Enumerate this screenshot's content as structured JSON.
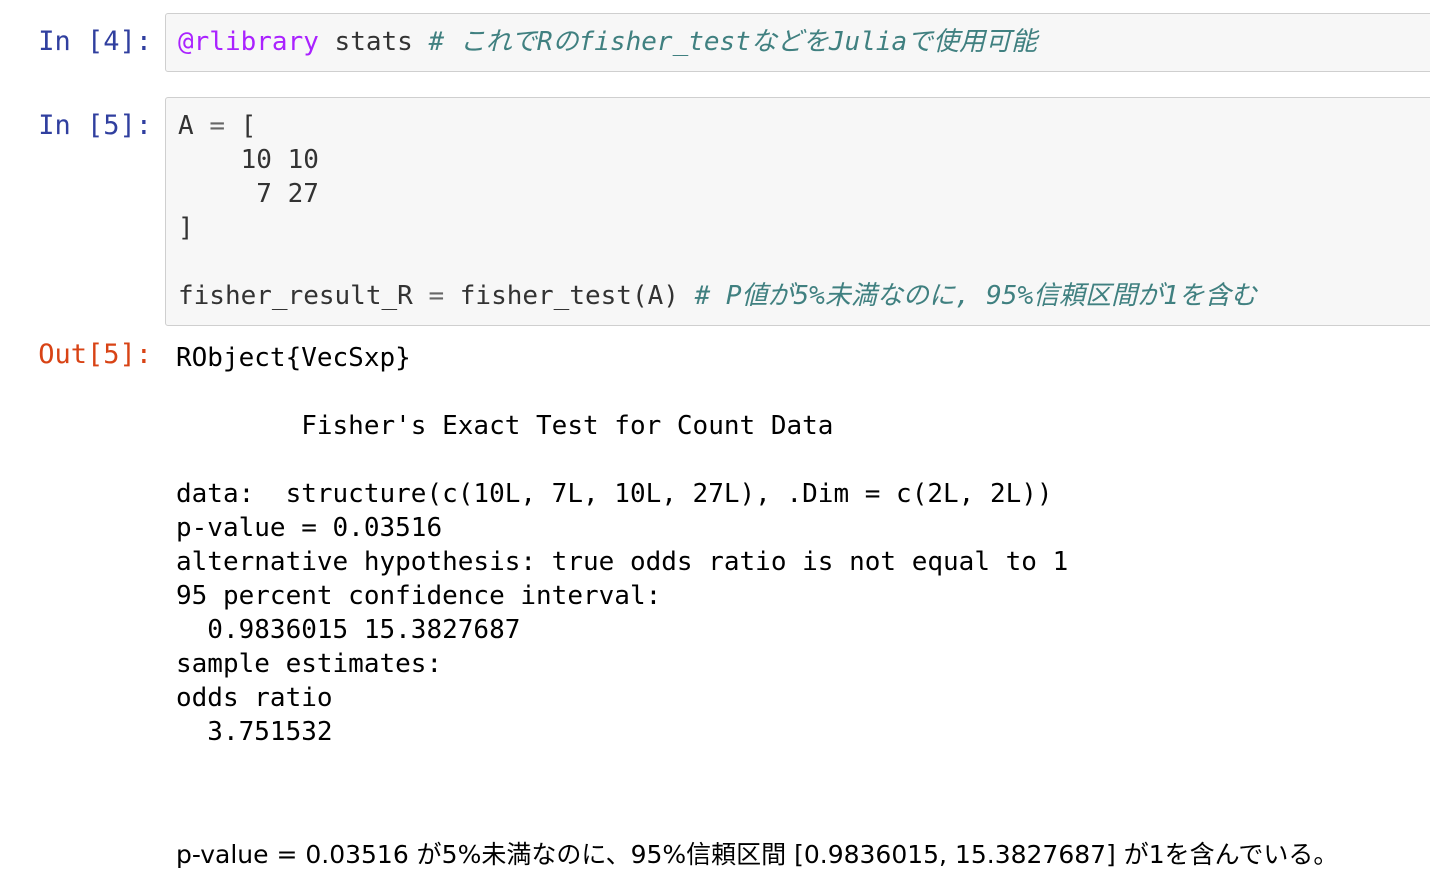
{
  "cells": [
    {
      "prompt": "In [4]:",
      "code": [
        {
          "text": "@rlibrary",
          "cls": "tok-macro"
        },
        {
          "text": " stats ",
          "cls": ""
        },
        {
          "text": "# これでRのfisher_testなどをJuliaで使用可能",
          "cls": "tok-comment"
        }
      ]
    },
    {
      "prompt": "In [5]:",
      "code": [
        {
          "text": "A ",
          "cls": ""
        },
        {
          "text": "=",
          "cls": "tok-op"
        },
        {
          "text": " [\n    10 10\n     7 27\n]\n\nfisher_result_R ",
          "cls": ""
        },
        {
          "text": "=",
          "cls": "tok-op"
        },
        {
          "text": " fisher_test(A) ",
          "cls": ""
        },
        {
          "text": "# P値が5%未満なのに, 95%信頼区間が1を含む",
          "cls": "tok-comment"
        }
      ]
    }
  ],
  "output": {
    "prompt": "Out[5]:",
    "lines": [
      "RObject{VecSxp}",
      "",
      "        Fisher's Exact Test for Count Data",
      "",
      "data:  structure(c(10L, 7L, 10L, 27L), .Dim = c(2L, 2L))",
      "p-value = 0.03516",
      "alternative hypothesis: true odds ratio is not equal to 1",
      "95 percent confidence interval:",
      "  0.9836015 15.3827687",
      "sample estimates:",
      "odds ratio",
      "  3.751532"
    ]
  },
  "caption": "p-value = 0.03516 が5%未満なのに、95%信頼区間 [0.9836015, 15.3827687] が1を含んでいる。"
}
